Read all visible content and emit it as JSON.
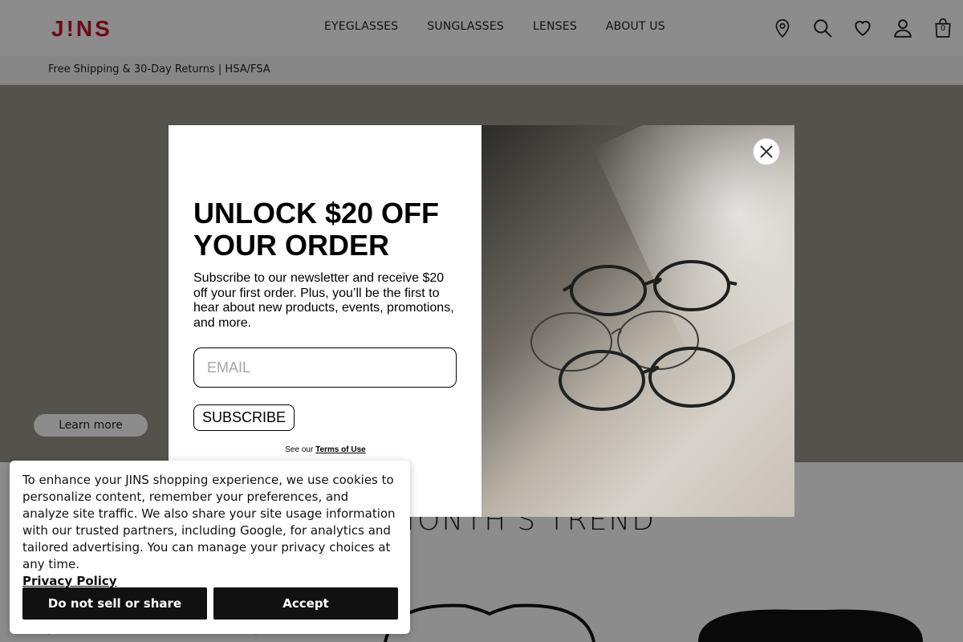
{
  "header": {
    "logo": "J!NS",
    "nav": [
      "EYEGLASSES",
      "SUNGLASSES",
      "LENSES",
      "ABOUT US"
    ],
    "bag_count": "0",
    "icons": [
      "location-pin-icon",
      "search-icon",
      "heart-icon",
      "user-icon",
      "shopping-bag-icon"
    ]
  },
  "promo": {
    "text": "Free Shipping & 30-Day Returns | HSA/FSA"
  },
  "hero": {
    "cta_label": "Learn more"
  },
  "trend": {
    "title": "THIS MONTH'S TREND"
  },
  "modal": {
    "title": "UNLOCK $20 OFF YOUR ORDER",
    "copy": "Subscribe to our newsletter and receive $20 off your first order. Plus, you’ll be the first to hear about new products, events, promotions, and more.",
    "email_placeholder": "EMAIL",
    "subscribe_label": "SUBSCRIBE",
    "terms_prefix": "See our",
    "terms_link": "Terms of Use"
  },
  "cookie": {
    "text": "To enhance your JINS shopping experience, we use cookies to personalize content, remember your preferences, and analyze site traffic. We also share your site usage information with our trusted partners, including Google, for analytics and tailored advertising. You can manage your privacy choices at any time.",
    "link": "Privacy Policy",
    "decline_label": "Do not sell or share",
    "accept_label": "Accept"
  },
  "colors": {
    "brand": "#c8102e",
    "overlay": "rgba(0,0,0,0.45)"
  }
}
